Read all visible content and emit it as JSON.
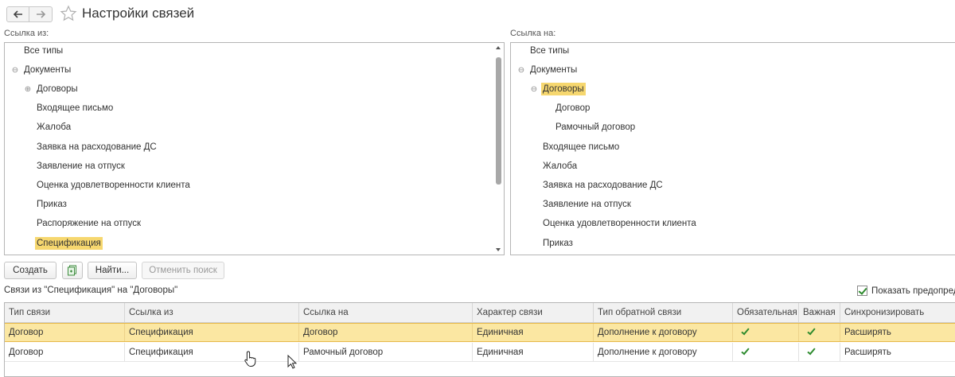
{
  "header": {
    "title": "Настройки связей",
    "back_icon": "arrow-left-icon",
    "forward_icon": "arrow-right-icon",
    "favorite_icon": "star-icon"
  },
  "link_from": {
    "label": "Ссылка из:",
    "items": [
      {
        "label": "Все типы",
        "toggle": ""
      },
      {
        "label": "Документы",
        "toggle": "⊖"
      },
      {
        "label": "Договоры",
        "toggle": "⊕"
      },
      {
        "label": "Входящее письмо",
        "toggle": ""
      },
      {
        "label": "Жалоба",
        "toggle": ""
      },
      {
        "label": "Заявка на расходование ДС",
        "toggle": ""
      },
      {
        "label": "Заявление на отпуск",
        "toggle": ""
      },
      {
        "label": "Оценка удовлетворенности клиента",
        "toggle": ""
      },
      {
        "label": "Приказ",
        "toggle": ""
      },
      {
        "label": "Распоряжение на отпуск",
        "toggle": ""
      },
      {
        "label": "Спецификация",
        "toggle": "",
        "selected": true
      }
    ]
  },
  "link_to": {
    "label": "Ссылка на:",
    "items": [
      {
        "label": "Все типы",
        "toggle": ""
      },
      {
        "label": "Документы",
        "toggle": "⊖"
      },
      {
        "label": "Договоры",
        "toggle": "⊖",
        "selected": true
      },
      {
        "label": "Договор",
        "toggle": ""
      },
      {
        "label": "Рамочный договор",
        "toggle": ""
      },
      {
        "label": "Входящее письмо",
        "toggle": ""
      },
      {
        "label": "Жалоба",
        "toggle": ""
      },
      {
        "label": "Заявка на расходование ДС",
        "toggle": ""
      },
      {
        "label": "Заявление на отпуск",
        "toggle": ""
      },
      {
        "label": "Оценка удовлетворенности клиента",
        "toggle": ""
      },
      {
        "label": "Приказ",
        "toggle": ""
      }
    ]
  },
  "toolbar": {
    "create_label": "Создать",
    "copy_icon": "copy-document-icon",
    "find_label": "Найти...",
    "cancel_search_label": "Отменить поиск"
  },
  "links_section": {
    "label": "Связи из \"Спецификация\" на \"Договоры\"",
    "show_predefined_label": "Показать предопределенные",
    "show_predefined_checked": true
  },
  "grid": {
    "columns": [
      "Тип связи",
      "Ссылка из",
      "Ссылка на",
      "Характер связи",
      "Тип обратной связи",
      "Обязательная",
      "Важная",
      "Синхронизировать"
    ],
    "rows": [
      {
        "cells": [
          "Договор",
          "Спецификация",
          "Договор",
          "Единичная",
          "Дополнение к договору",
          "✓",
          "✓",
          "Расширять"
        ],
        "selected": true
      },
      {
        "cells": [
          "Договор",
          "Спецификация",
          "Рамочный договор",
          "Единичная",
          "Дополнение к договору",
          "✓",
          "✓",
          "Расширять"
        ],
        "selected": false
      }
    ]
  },
  "colors": {
    "selection": "#f6d76f",
    "row_selection": "#fbe7a2",
    "check": "#2e8b2e"
  }
}
